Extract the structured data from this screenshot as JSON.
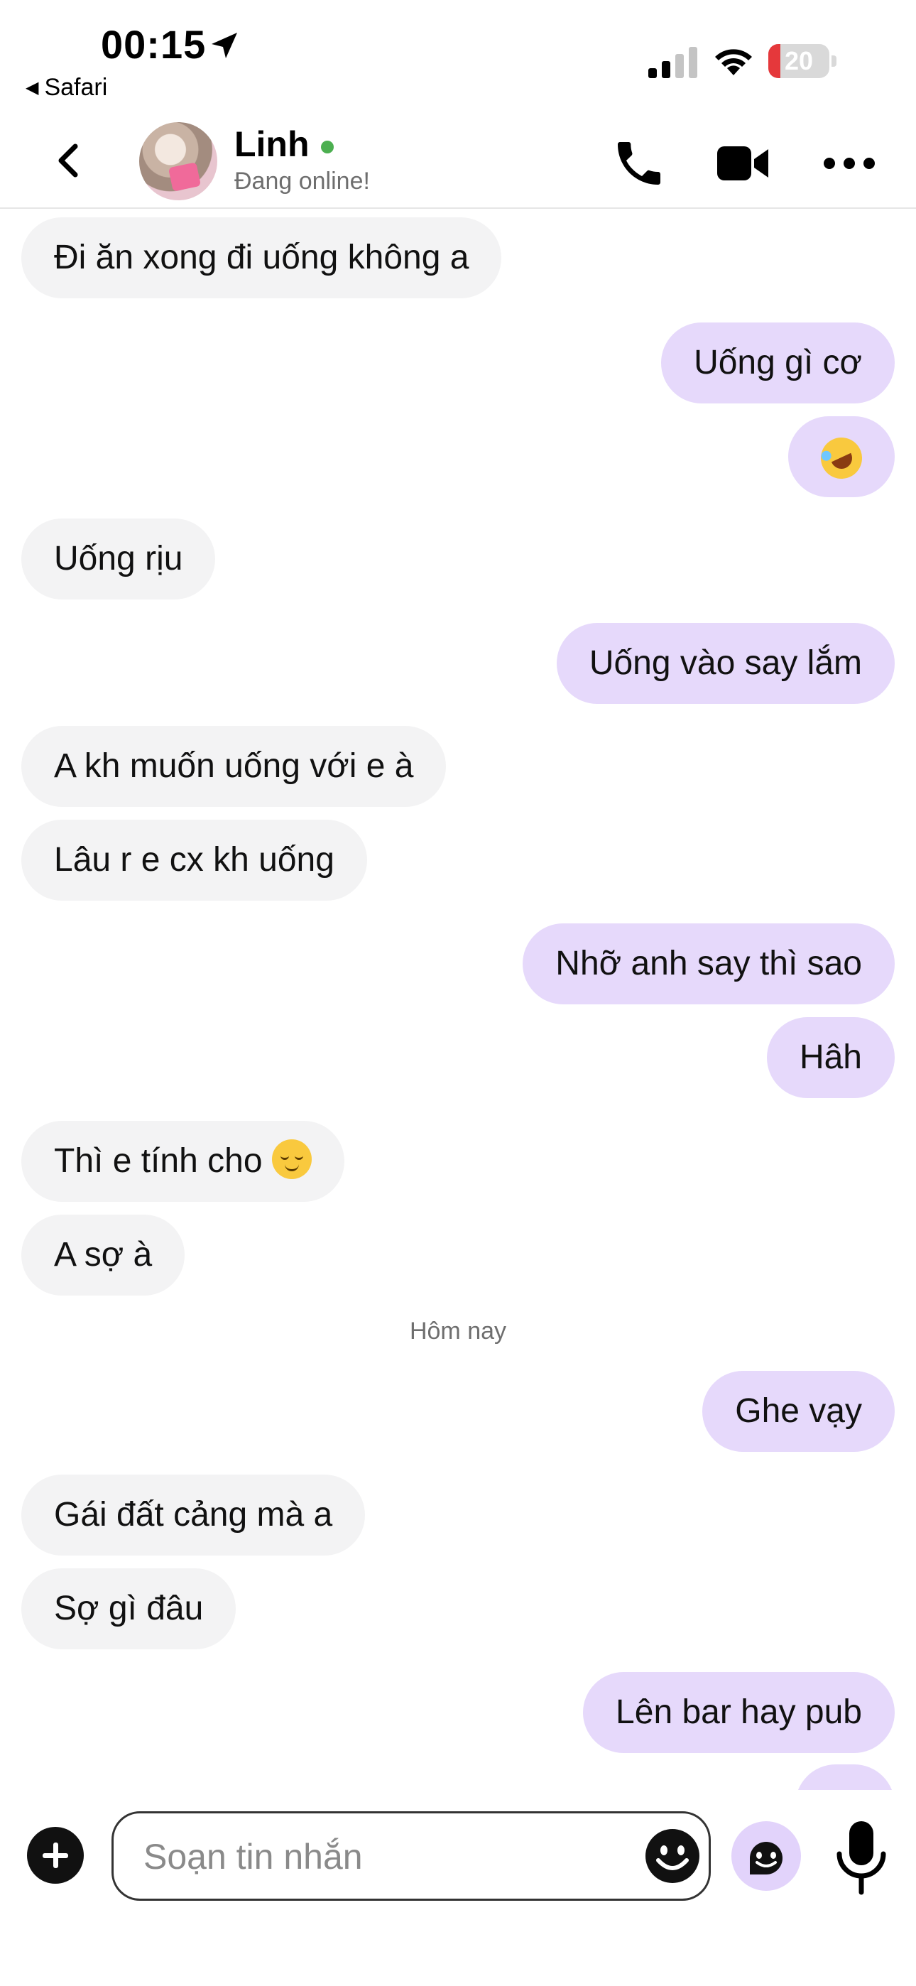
{
  "status_bar": {
    "time": "00:15",
    "back_app": "Safari",
    "battery_level": "20",
    "battery_fraction": 0.2
  },
  "header": {
    "contact_name": "Linh",
    "contact_status": "Đang online!"
  },
  "messages": [
    {
      "side": "in",
      "text": "Đi ăn xong đi uống không a"
    },
    {
      "side": "out",
      "text": "Uống gì cơ"
    },
    {
      "side": "out",
      "text": "",
      "emoji": "rolling-on-floor-laughing"
    },
    {
      "side": "in",
      "text": "Uống rịu"
    },
    {
      "side": "out",
      "text": "Uống vào say lắm"
    },
    {
      "side": "in",
      "text": "A kh muốn uống với e à"
    },
    {
      "side": "in",
      "text": "Lâu r e cx kh uống"
    },
    {
      "side": "out",
      "text": "Nhỡ anh say thì sao"
    },
    {
      "side": "out",
      "text": "Hâh"
    },
    {
      "side": "in",
      "text": "Thì e tính cho ",
      "emoji": "relieved-face"
    },
    {
      "side": "in",
      "text": "A sợ à"
    },
    {
      "side": "out",
      "text": "Ghe vạy"
    },
    {
      "side": "in",
      "text": "Gái đất cảng mà a"
    },
    {
      "side": "in",
      "text": "Sợ gì đâu"
    },
    {
      "side": "out",
      "text": "Lên bar hay pub"
    },
    {
      "side": "out",
      "text": ")))"
    }
  ],
  "date_separator": "Hôm nay",
  "composer": {
    "placeholder": "Soạn tin nhắn"
  },
  "colors": {
    "incoming_bubble": "#f3f3f4",
    "outgoing_bubble": "#e6d9fb",
    "online_dot": "#4caf50",
    "battery_low": "#e5383b"
  }
}
